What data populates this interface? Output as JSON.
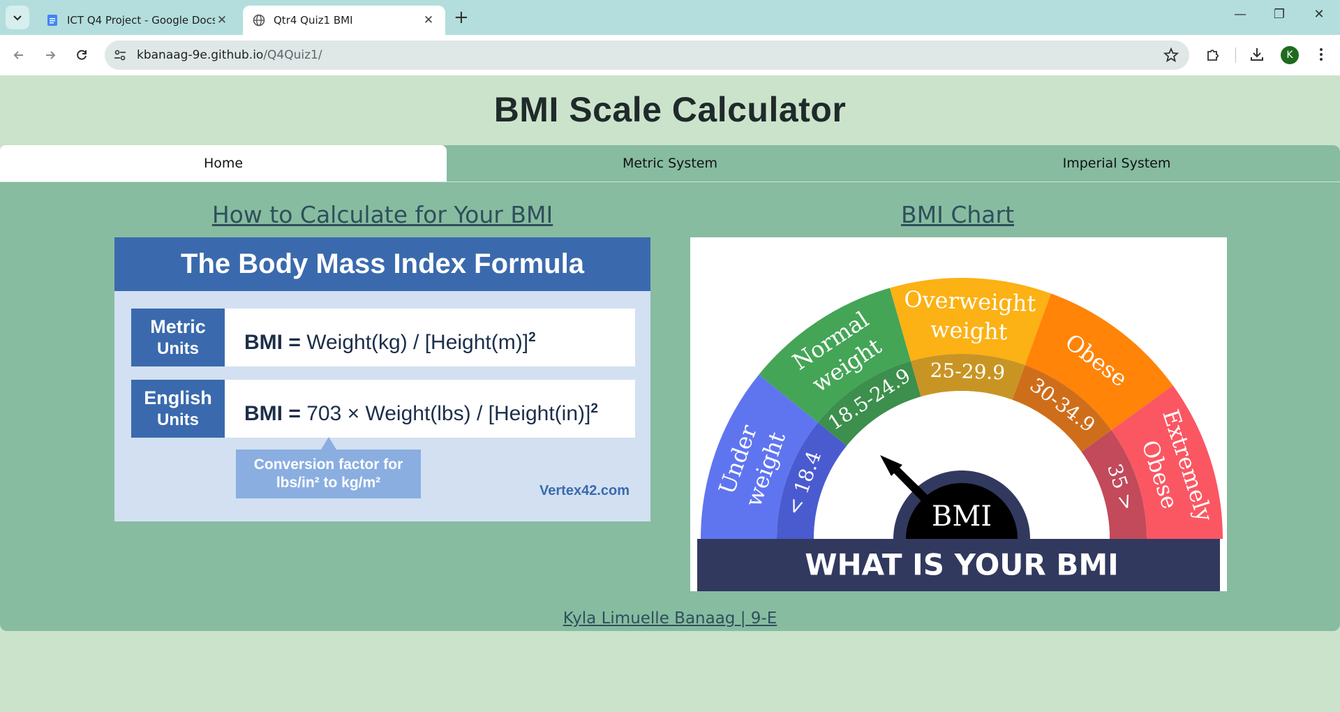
{
  "browser": {
    "tabs": [
      {
        "title": "ICT Q4 Project - Google Docs",
        "active": false,
        "favicon": "google-docs-icon"
      },
      {
        "title": "Qtr4 Quiz1 BMI",
        "active": true,
        "favicon": "globe-icon"
      }
    ],
    "url_host": "kbanaag-9e.github.io",
    "url_path": "/Q4Quiz1/",
    "profile_initial": "K"
  },
  "page": {
    "title": "BMI Scale Calculator",
    "nav": [
      "Home",
      "Metric System",
      "Imperial System"
    ],
    "active_nav": "Home",
    "left_heading": "How to Calculate for Your BMI",
    "right_heading": "BMI Chart",
    "footer": "Kyla Limuelle Banaag | 9-E"
  },
  "formula_image": {
    "title": "The Body Mass Index Formula",
    "metric_label_1": "Metric",
    "metric_label_2": "Units",
    "metric_bmi": "BMI =",
    "metric_formula": "Weight(kg) / [Height(m)]",
    "english_label_1": "English",
    "english_label_2": "Units",
    "english_bmi": "BMI =",
    "english_formula": "703 × Weight(lbs) / [Height(in)]",
    "exponent": "2",
    "note_1": "Conversion factor for",
    "note_2": "lbs/in² to kg/m²",
    "credit": "Vertex42.com"
  },
  "bmi_chart_image": {
    "segments": [
      {
        "label_1": "Under",
        "label_2": "weight",
        "range": "< 18.4",
        "color": "#5f75f0",
        "inner": "#4a5bd0"
      },
      {
        "label_1": "Normal",
        "label_2": "weight",
        "range": "18.5-24.9",
        "color": "#44a556",
        "inner": "#3c8f4c"
      },
      {
        "label_1": "Overweight",
        "label_2": "weight",
        "range": "25-29.9",
        "color": "#fcb114",
        "inner": "#c89524"
      },
      {
        "label_1": "Obese",
        "label_2": "",
        "range": "30-34.9",
        "color": "#ff8407",
        "inner": "#cf6e1a"
      },
      {
        "label_1": "Extremely",
        "label_2": "Obese",
        "range": "35 >",
        "color": "#fa5763",
        "inner": "#c24a5a"
      }
    ],
    "center_label": "BMI",
    "banner": "WHAT IS YOUR BMI",
    "banner_color": "#31395f"
  }
}
